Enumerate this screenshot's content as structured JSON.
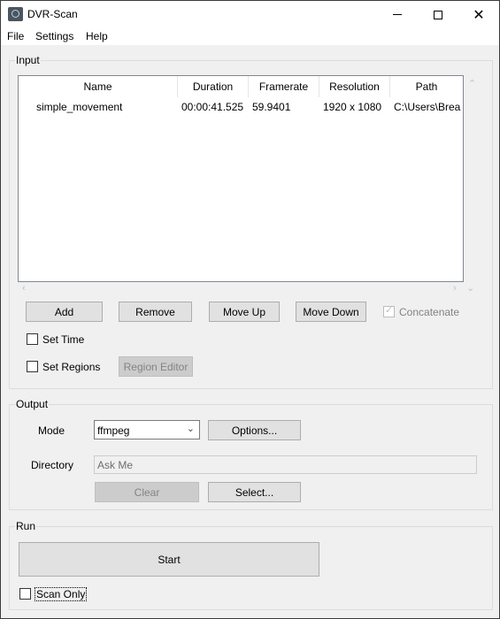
{
  "window": {
    "title": "DVR-Scan",
    "minimize_icon": "minimize-icon",
    "maximize_icon": "maximize-icon",
    "close_icon": "close-icon"
  },
  "menubar": {
    "items": [
      "File",
      "Settings",
      "Help"
    ]
  },
  "input": {
    "group_label": "Input",
    "table": {
      "columns": [
        "Name",
        "Duration",
        "Framerate",
        "Resolution",
        "Path"
      ],
      "rows": [
        {
          "name": "simple_movement",
          "duration": "00:00:41.525",
          "framerate": "59.9401",
          "resolution": "1920 x 1080",
          "path": "C:\\Users\\Brea"
        }
      ]
    },
    "buttons": {
      "add": "Add",
      "remove": "Remove",
      "move_up": "Move Up",
      "move_down": "Move Down",
      "region_editor": "Region Editor"
    },
    "concatenate": {
      "label": "Concatenate",
      "checked": true,
      "enabled": false
    },
    "set_time": {
      "label": "Set Time",
      "checked": false
    },
    "set_regions": {
      "label": "Set Regions",
      "checked": false
    }
  },
  "output": {
    "group_label": "Output",
    "mode_label": "Mode",
    "mode_value": "ffmpeg",
    "options_button": "Options...",
    "directory_label": "Directory",
    "directory_placeholder": "Ask Me",
    "clear_button": "Clear",
    "select_button": "Select..."
  },
  "run": {
    "group_label": "Run",
    "start_button": "Start",
    "scan_only": {
      "label": "Scan Only",
      "checked": false
    }
  }
}
